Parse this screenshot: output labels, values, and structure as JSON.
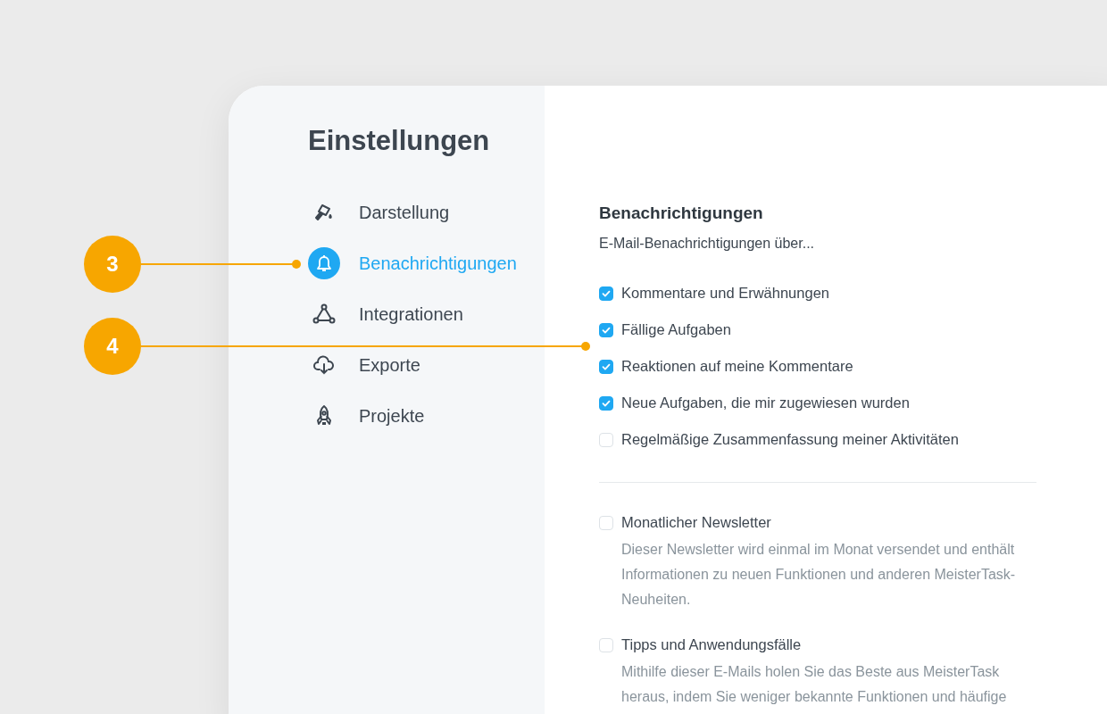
{
  "sidebar": {
    "title": "Einstellungen",
    "items": [
      {
        "label": "Darstellung",
        "selected": false
      },
      {
        "label": "Benachrichtigungen",
        "selected": true
      },
      {
        "label": "Integrationen",
        "selected": false
      },
      {
        "label": "Exporte",
        "selected": false
      },
      {
        "label": "Projekte",
        "selected": false
      }
    ]
  },
  "content": {
    "heading": "Benachrichtigungen",
    "subtitle": "E-Mail-Benachrichtigungen über...",
    "email_options": [
      {
        "label": "Kommentare und Erwähnungen",
        "checked": true
      },
      {
        "label": "Fällige Aufgaben",
        "checked": true
      },
      {
        "label": "Reaktionen auf meine Kommentare",
        "checked": true
      },
      {
        "label": "Neue Aufgaben, die mir zugewiesen wurden",
        "checked": true
      },
      {
        "label": "Regelmäßige Zusammenfassung meiner Aktivitäten",
        "checked": false
      }
    ],
    "newsletters": [
      {
        "label": "Monatlicher Newsletter",
        "checked": false,
        "description_lines": [
          "Dieser Newsletter wird einmal im Monat versendet und enthält",
          "Informationen zu neuen Funktionen und anderen MeisterTask-",
          "Neuheiten."
        ]
      },
      {
        "label": "Tipps und Anwendungsfälle",
        "checked": false,
        "description_lines": [
          "Mithilfe dieser E-Mails holen Sie das Beste aus MeisterTask",
          "heraus, indem Sie weniger bekannte Funktionen und häufige"
        ]
      }
    ]
  },
  "callouts": [
    {
      "label": "3"
    },
    {
      "label": "4"
    }
  ]
}
